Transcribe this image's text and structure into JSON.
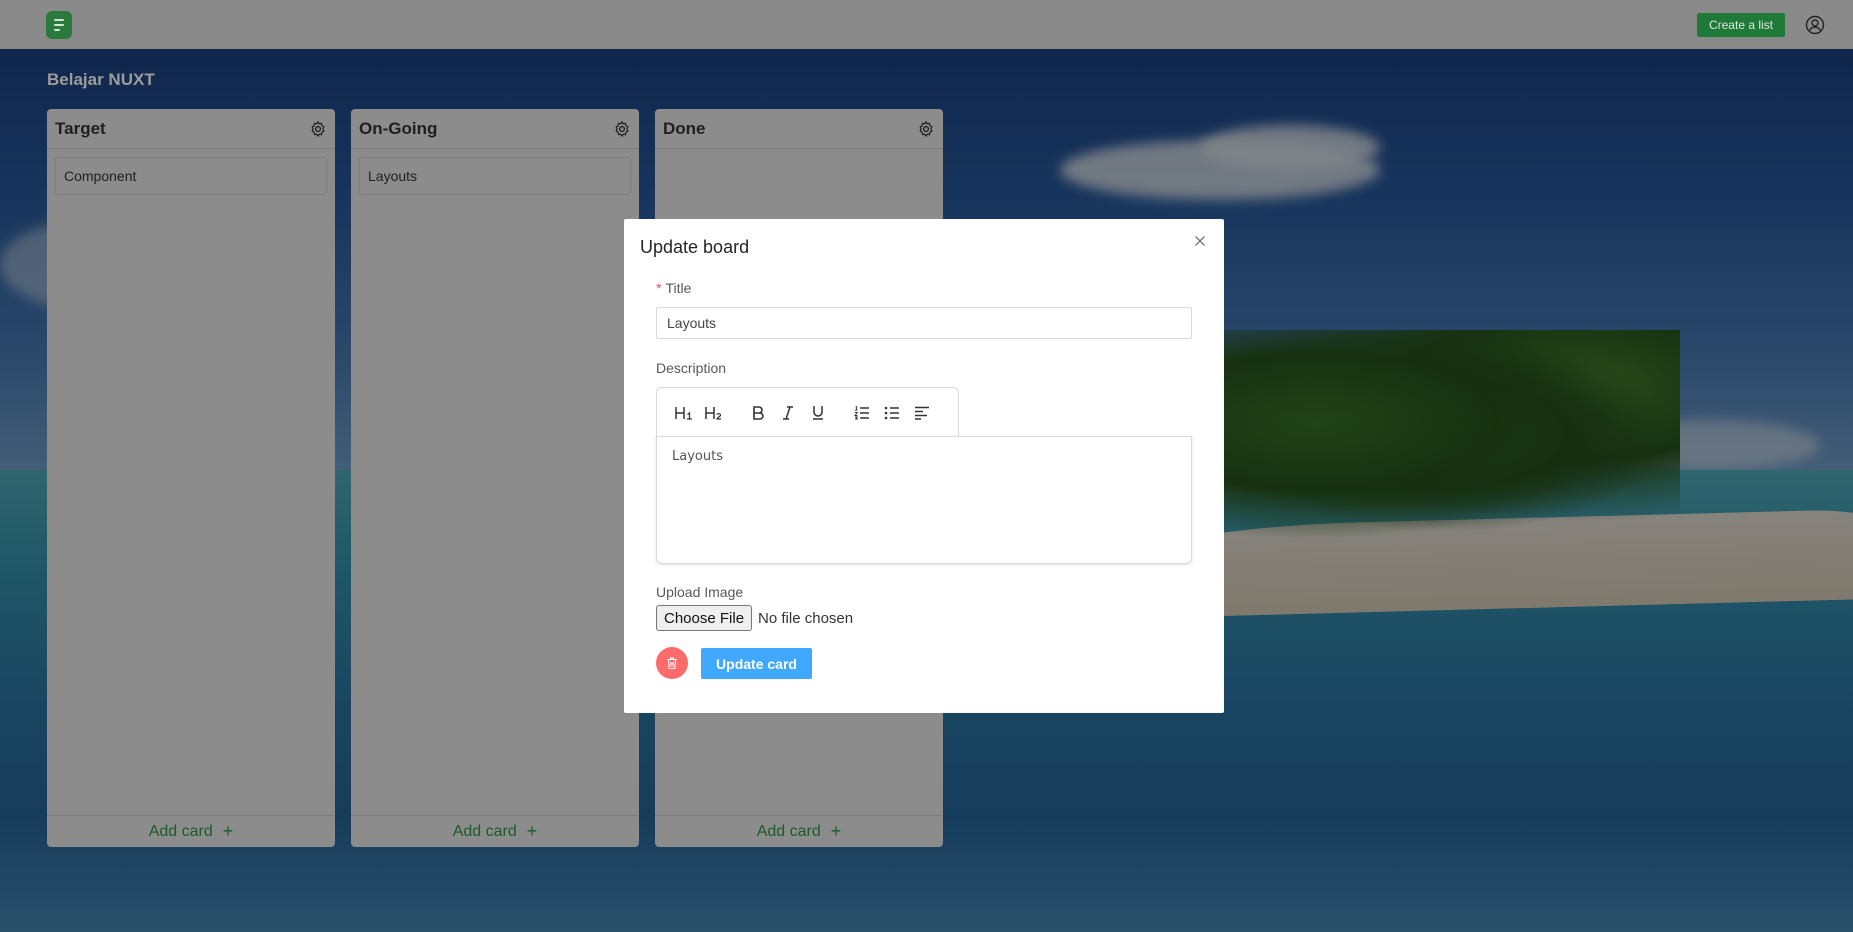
{
  "header": {
    "create_label": "Create a list",
    "logo_icon": "list-document-icon",
    "user_icon": "user-circle-icon",
    "brand_color": "#2a7a3e"
  },
  "board": {
    "title": "Belajar NUXT"
  },
  "columns": [
    {
      "title": "Target",
      "cards": [
        "Component"
      ],
      "footer_label": "Add card"
    },
    {
      "title": "On-Going",
      "cards": [
        "Layouts"
      ],
      "footer_label": "Add card"
    },
    {
      "title": "Done",
      "cards": [],
      "footer_label": "Add card"
    }
  ],
  "modal": {
    "title": "Update board",
    "title_field": {
      "label": "Title",
      "required_mark": "*",
      "value": "Layouts"
    },
    "description": {
      "label": "Description",
      "toolbar": [
        "H1",
        "H2",
        "bold",
        "italic",
        "underline",
        "ordered-list",
        "bullet-list",
        "align-left"
      ],
      "content": "Layouts"
    },
    "upload": {
      "label": "Upload Image",
      "button_label": "Choose File",
      "status": "No file chosen"
    },
    "update_label": "Update card",
    "accent_color": "#40a9ff",
    "danger_color": "#ff6b6b"
  }
}
